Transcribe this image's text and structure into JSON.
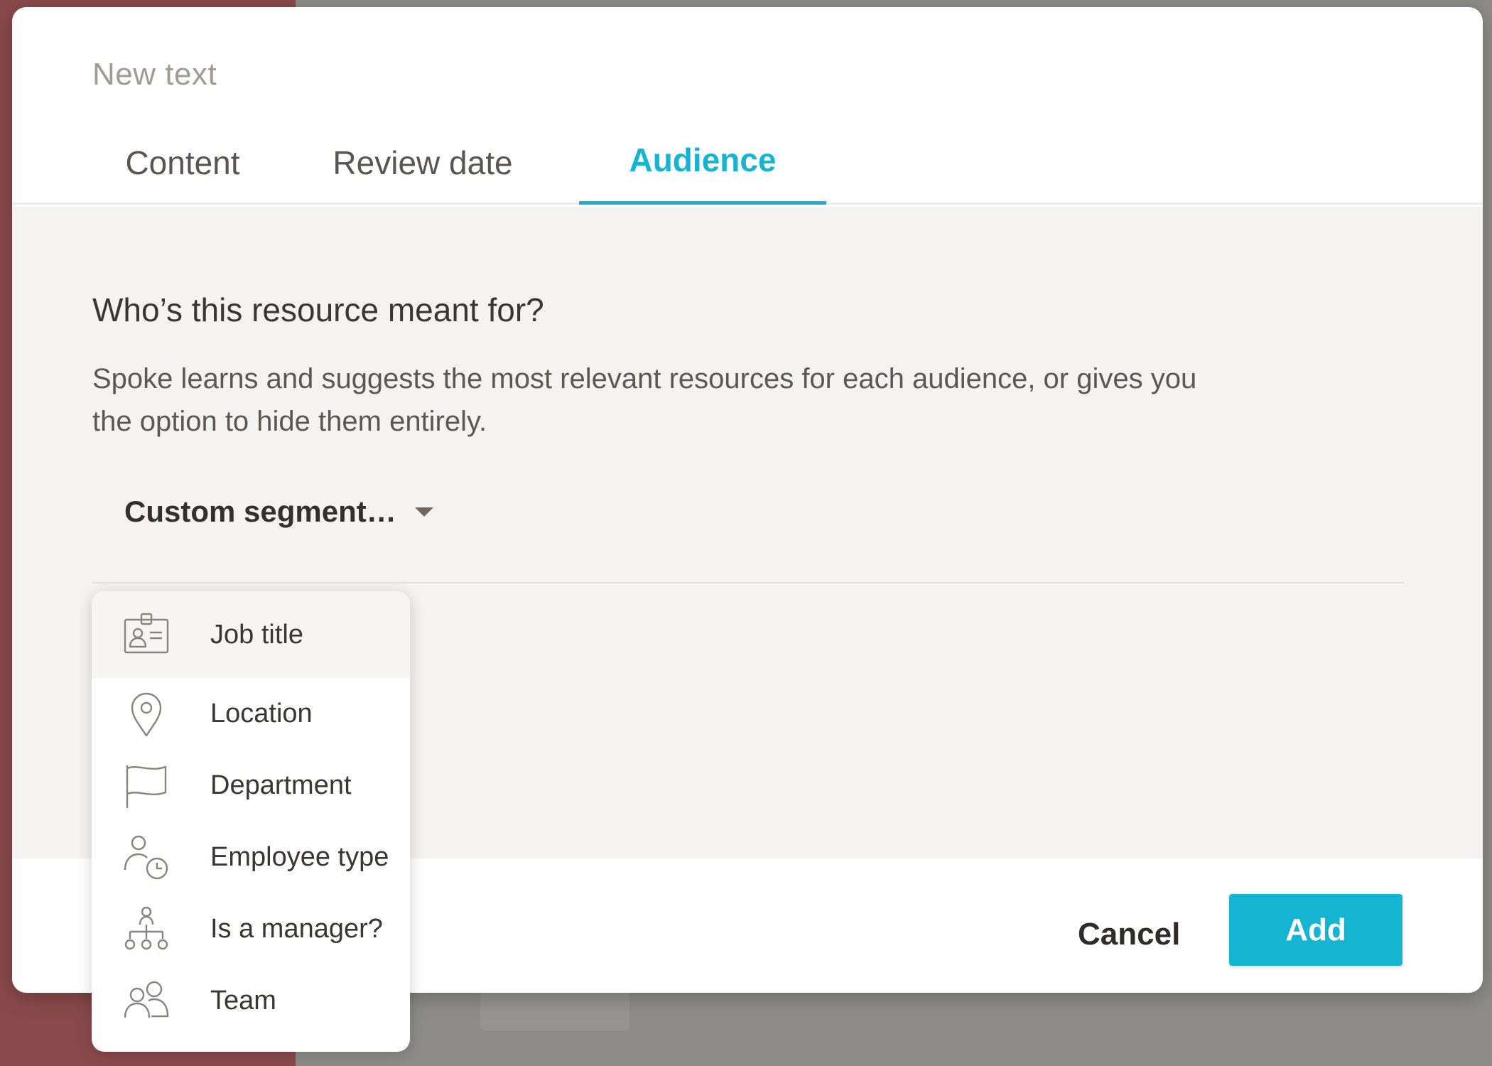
{
  "modal": {
    "title": "New text",
    "tabs": [
      {
        "label": "Content",
        "active": false
      },
      {
        "label": "Review date",
        "active": false
      },
      {
        "label": "Audience",
        "active": true
      }
    ],
    "question": "Who’s this resource meant for?",
    "description": "Spoke learns and suggests the most relevant resources for each audience, or gives you the option to hide them entirely.",
    "segment_select": {
      "selected": "Custom segment…",
      "icon": "caret-down-icon"
    },
    "footer": {
      "cancel_label": "Cancel",
      "add_label": "Add"
    }
  },
  "segment_menu": {
    "items": [
      {
        "label": "Job title",
        "icon": "id-badge-icon",
        "highlighted": true
      },
      {
        "label": "Location",
        "icon": "map-pin-icon",
        "highlighted": false
      },
      {
        "label": "Department",
        "icon": "flag-icon",
        "highlighted": false
      },
      {
        "label": "Employee type",
        "icon": "person-clock-icon",
        "highlighted": false
      },
      {
        "label": "Is a manager?",
        "icon": "org-chart-icon",
        "highlighted": false
      },
      {
        "label": "Team",
        "icon": "team-icon",
        "highlighted": false
      }
    ]
  },
  "colors": {
    "accent": "#14b4d2",
    "tab_inactive": "#5a5551",
    "body_bg": "#f4f3f1",
    "icon_stroke": "#8a847e"
  }
}
